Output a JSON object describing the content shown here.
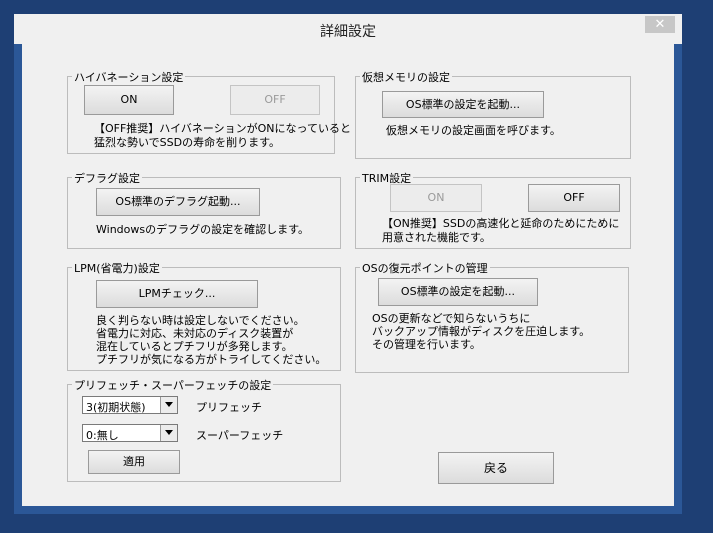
{
  "window": {
    "title": "詳細設定",
    "close_icon": "close-icon"
  },
  "hibernation": {
    "group_title": "ハイバネーション設定",
    "on_label": "ON",
    "off_label": "OFF",
    "desc_lines": [
      "【OFF推奨】ハイバネーションがONになっていると",
      "猛烈な勢いでSSDの寿命を削ります。"
    ]
  },
  "virtual_memory": {
    "group_title": "仮想メモリの設定",
    "button_label": "OS標準の設定を起動...",
    "desc": "仮想メモリの設定画面を呼びます。"
  },
  "defrag": {
    "group_title": "デフラグ設定",
    "button_label": "OS標準のデフラグ起動...",
    "desc": "Windowsのデフラグの設定を確認します。"
  },
  "trim": {
    "group_title": "TRIM設定",
    "on_label": "ON",
    "off_label": "OFF",
    "desc_lines": [
      "【ON推奨】SSDの高速化と延命のためにために",
      "用意された機能です。"
    ]
  },
  "lpm": {
    "group_title": "LPM(省電力)設定",
    "button_label": "LPMチェック...",
    "desc_lines": [
      "良く判らない時は設定しないでください。",
      "省電力に対応、未対応のディスク装置が",
      "混在しているとプチフリが多発します。",
      "プチフリが気になる方がトライしてください。"
    ]
  },
  "restore": {
    "group_title": "OSの復元ポイントの管理",
    "button_label": "OS標準の設定を起動...",
    "desc_lines": [
      "OSの更新などで知らないうちに",
      "バックアップ情報がディスクを圧迫します。",
      "その管理を行います。"
    ]
  },
  "prefetch": {
    "group_title": "プリフェッチ・スーパーフェッチの設定",
    "prefetch_value": "3(初期状態)",
    "prefetch_label": "プリフェッチ",
    "superfetch_value": "0:無し",
    "superfetch_label": "スーパーフェッチ",
    "apply_label": "適用"
  },
  "back_label": "戻る"
}
